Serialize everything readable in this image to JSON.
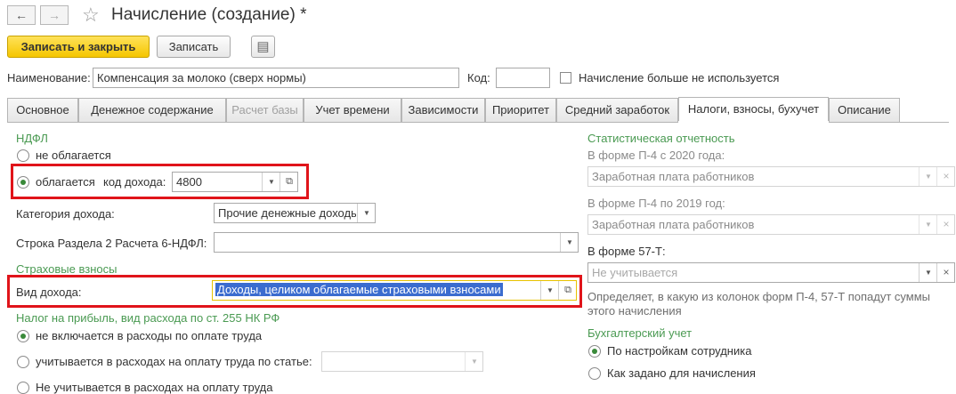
{
  "window": {
    "title": "Начисление (создание) *",
    "back_icon": "←",
    "forward_icon": "→",
    "star_icon": "☆"
  },
  "toolbar": {
    "save_close_label": "Записать и закрыть",
    "save_label": "Записать",
    "doc_icon": "▤"
  },
  "header": {
    "name_label": "Наименование:",
    "name_value": "Компенсация за молоко (сверх нормы)",
    "code_label": "Код:",
    "code_value": "",
    "unused_label": "Начисление больше не используется"
  },
  "tabs": [
    {
      "label": "Основное"
    },
    {
      "label": "Денежное содержание"
    },
    {
      "label": "Расчет базы"
    },
    {
      "label": "Учет времени"
    },
    {
      "label": "Зависимости"
    },
    {
      "label": "Приоритет"
    },
    {
      "label": "Средний заработок"
    },
    {
      "label": "Налоги, взносы, бухучет"
    },
    {
      "label": "Описание"
    }
  ],
  "ndfl": {
    "section": "НДФЛ",
    "not_taxed": "не облагается",
    "taxed": "облагается",
    "income_code_label": "код дохода:",
    "income_code_value": "4800",
    "category_label": "Категория дохода:",
    "category_value": "Прочие денежные доходы",
    "row6_label": "Строка Раздела 2 Расчета 6-НДФЛ:",
    "row6_value": ""
  },
  "insurance": {
    "section": "Страховые взносы",
    "income_type_label": "Вид дохода:",
    "income_type_value": "Доходы, целиком облагаемые страховыми взносами"
  },
  "profit_tax": {
    "section": "Налог на прибыль, вид расхода по ст. 255 НК РФ",
    "opt1": "не включается в расходы по оплате труда",
    "opt2": "учитывается в расходах на оплату труда по статье:",
    "opt2_value": "",
    "opt3": "Не учитывается в расходах на оплату труда"
  },
  "statistics": {
    "section": "Статистическая отчетность",
    "p4_2020_label": "В форме П-4 с 2020 года:",
    "p4_2020_value": "Заработная плата работников",
    "p4_2019_label": "В форме П-4 по 2019 год:",
    "p4_2019_value": "Заработная плата работников",
    "f57t_label": "В форме 57-Т:",
    "f57t_placeholder": "Не учитывается",
    "note": "Определяет, в какую из колонок форм П-4, 57-Т попадут суммы этого начисления"
  },
  "accounting": {
    "section": "Бухгалтерский учет",
    "opt1": "По настройкам сотрудника",
    "opt2": "Как задано для начисления"
  },
  "colors": {
    "accent_yellow": "#f5c600",
    "section_green": "#4a9a52",
    "highlight_red": "#e0141a",
    "selection_blue": "#3b6ccf"
  }
}
